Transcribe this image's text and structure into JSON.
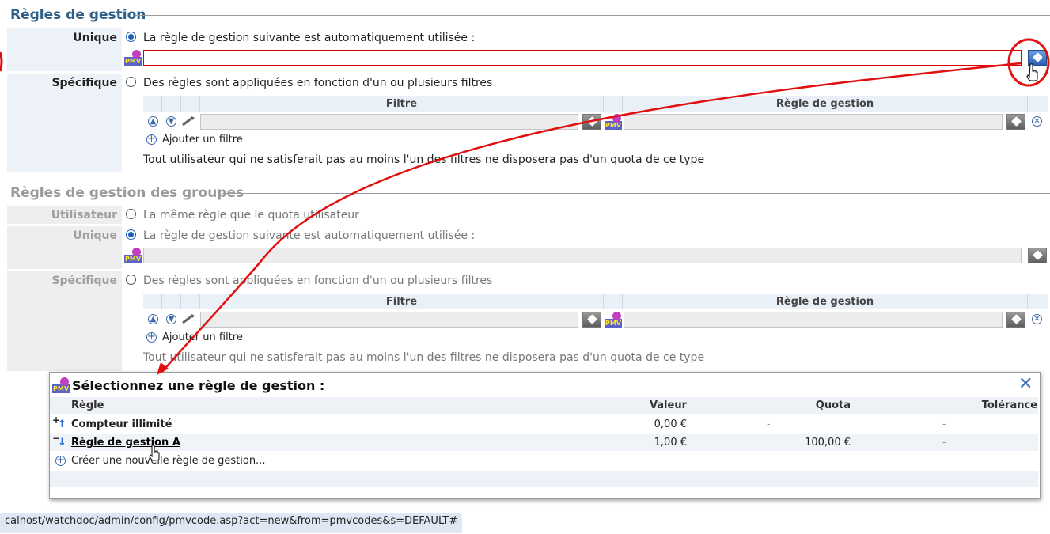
{
  "section1": {
    "title": "Règles de gestion",
    "unique_label": "Unique",
    "unique_text": "La règle de gestion suivante est automatiquement utilisée :",
    "specific_label": "Spécifique",
    "specific_text": "Des règles sont appliquées en fonction d'un ou plusieurs filtres",
    "col_filter": "Filtre",
    "col_rule": "Règle de gestion",
    "add_filter": "Ajouter un filtre",
    "note": "Tout utilisateur qui ne satisferait pas au moins l'un des filtres ne disposera pas d'un quota de ce type"
  },
  "section2": {
    "title": "Règles de gestion des groupes",
    "user_label": "Utilisateur",
    "user_text": "La même règle que le quota utilisateur",
    "unique_label": "Unique",
    "unique_text": "La règle de gestion suivante est automatiquement utilisée :",
    "specific_label": "Spécifique",
    "specific_text": "Des règles sont appliquées en fonction d'un ou plusieurs filtres",
    "col_filter": "Filtre",
    "col_rule": "Règle de gestion",
    "add_filter": "Ajouter un filtre",
    "note": "Tout utilisateur qui ne satisferait pas au moins l'un des filtres ne disposera pas d'un quota de ce type"
  },
  "popup": {
    "title": "Sélectionnez une règle de gestion :",
    "columns": {
      "rule": "Règle",
      "value": "Valeur",
      "quota": "Quota",
      "tolerance": "Tolérance"
    },
    "rows": [
      {
        "prefix": "+",
        "name": "Compteur illimité",
        "value": "0,00 €",
        "quota": "-",
        "tolerance": "-"
      },
      {
        "prefix": "−",
        "name": "Règle de gestion A",
        "value": "1,00 €",
        "quota": "100,00 €",
        "tolerance": "-"
      }
    ],
    "create_link": "Créer une nouvelle règle de gestion..."
  },
  "status_bar": "calhost/watchdoc/admin/config/pmvcode.asp?act=new&from=pmvcodes&s=DEFAULT#",
  "icons": {
    "pmv_text": "PMV"
  },
  "colors": {
    "accent": "#2f5f86",
    "error": "#d00000",
    "annotation": "#e01010"
  }
}
